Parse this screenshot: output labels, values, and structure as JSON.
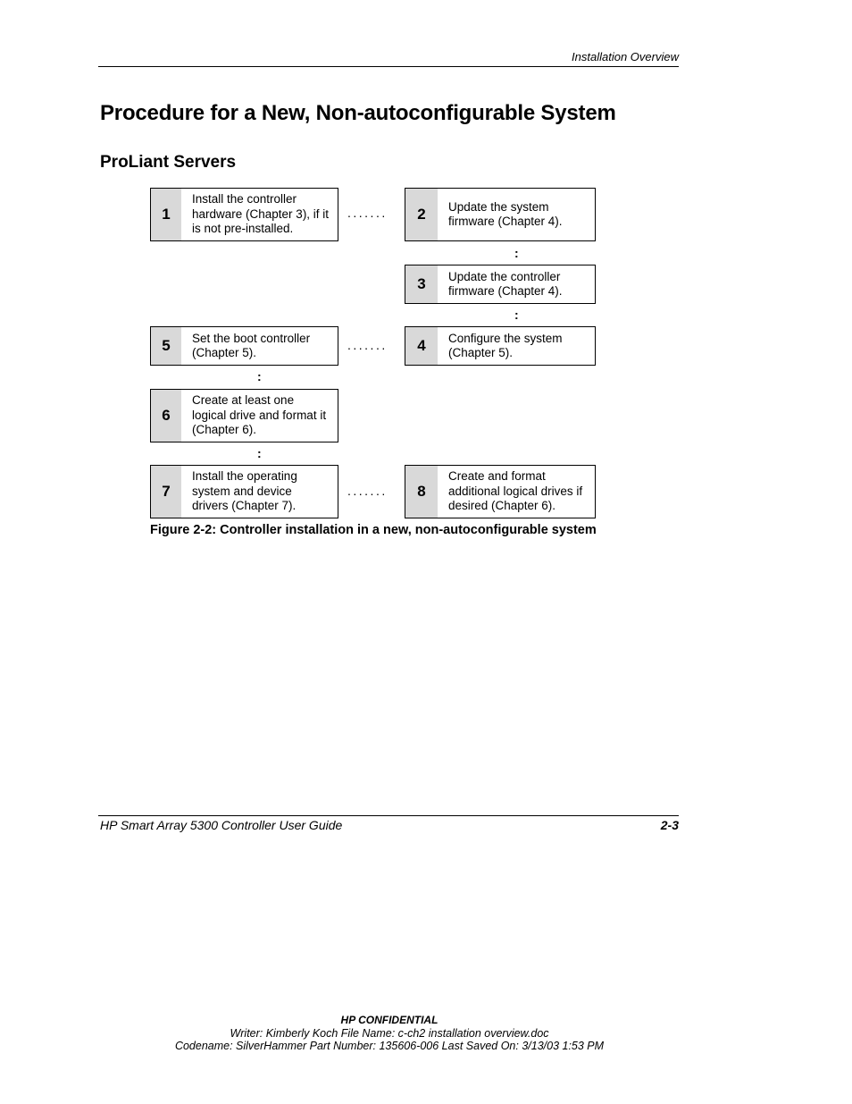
{
  "header": {
    "running_title": "Installation Overview"
  },
  "page_title": "Procedure for a New, Non-autoconfigurable System",
  "section_title": "ProLiant Servers",
  "figure": {
    "steps": [
      {
        "number": "1",
        "text": "Install the controller hardware (Chapter 3), if it is not pre-installed."
      },
      {
        "number": "2",
        "text": "Update the system firmware (Chapter 4)."
      },
      {
        "number": "3",
        "text": "Update the controller firmware (Chapter 4)."
      },
      {
        "number": "4",
        "text": "Configure the system (Chapter 5)."
      },
      {
        "number": "5",
        "text": "Set the boot controller (Chapter 5)."
      },
      {
        "number": "6",
        "text": "Create at least one logical drive and format it (Chapter 6)."
      },
      {
        "number": "7",
        "text": "Install the operating system and device drivers (Chapter 7)."
      },
      {
        "number": "8",
        "text": "Create and format additional logical drives if desired (Chapter 6)."
      }
    ],
    "horizontal_connector": ".......",
    "vertical_connector": ":",
    "caption": "Figure 2-2:  Controller installation in a new, non-autoconfigurable system"
  },
  "footer": {
    "guide_title": "HP Smart Array 5300 Controller User Guide",
    "page_number": "2-3"
  },
  "confidential": {
    "label": "HP CONFIDENTIAL",
    "line1": "Writer: Kimberly Koch File Name: c-ch2 installation overview.doc",
    "line2": "Codename: SilverHammer Part Number: 135606-006 Last Saved On: 3/13/03 1:53 PM"
  }
}
